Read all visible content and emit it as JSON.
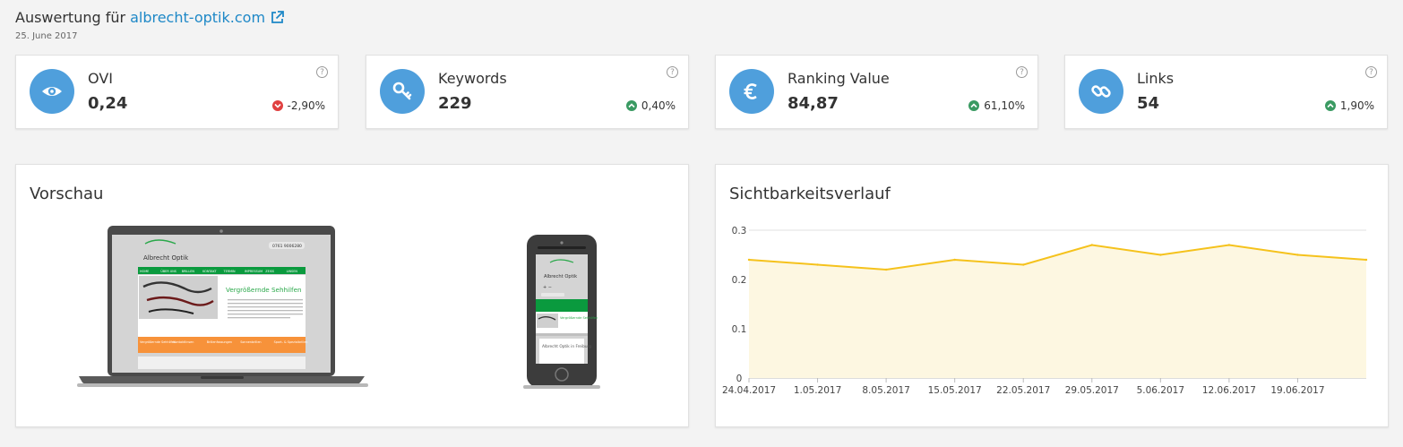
{
  "header": {
    "title_prefix": "Auswertung für",
    "domain": "albrecht-optik.com",
    "date": "25. June 2017"
  },
  "kpis": [
    {
      "label": "OVI",
      "value": "0,24",
      "change": "-2,90%",
      "direction": "down",
      "icon": "eye-icon"
    },
    {
      "label": "Keywords",
      "value": "229",
      "change": "0,40%",
      "direction": "up",
      "icon": "key-icon"
    },
    {
      "label": "Ranking Value",
      "value": "84,87",
      "change": "61,10%",
      "direction": "up",
      "icon": "euro-icon"
    },
    {
      "label": "Links",
      "value": "54",
      "change": "1,90%",
      "direction": "up",
      "icon": "link-icon"
    }
  ],
  "help_symbol": "?",
  "preview": {
    "title": "Vorschau",
    "site": {
      "logo_text": "Albrecht Optik",
      "phone": "0761 9006280",
      "nav_items": [
        "HOME",
        "ÜBER UNS",
        "BRILLEN",
        "KONTAKT",
        "TERMIN",
        "IMPRESSUM",
        "ZEISS",
        "LINSEN"
      ],
      "hero_title": "Vergrößernde Sehhilfen",
      "feature_items": [
        "Vergrößernde Sehhilfen",
        "Kontaktlinsen",
        "Brillenfassungen",
        "Sonnenbrillen",
        "Sport- & Spezialbrillen"
      ],
      "mobile_hero": "Vergrößernde Sehhilfen",
      "mobile_text": "Albrecht Optik in Freiburg"
    }
  },
  "visibility": {
    "title": "Sichtbarkeitsverlauf"
  },
  "colors": {
    "accent": "#4f9fdc",
    "link": "#1e88c7",
    "up": "#3a9a62",
    "down": "#e04040",
    "line": "#f5c21c",
    "area": "#fdf7e1"
  },
  "chart_data": {
    "type": "area",
    "x_ticks": [
      "24.04.2017",
      "1.05.2017",
      "8.05.2017",
      "15.05.2017",
      "22.05.2017",
      "29.05.2017",
      "5.06.2017",
      "12.06.2017",
      "19.06.2017"
    ],
    "x": [
      "24.04.2017",
      "1.05.2017",
      "8.05.2017",
      "15.05.2017",
      "22.05.2017",
      "29.05.2017",
      "5.06.2017",
      "12.06.2017",
      "19.06.2017",
      "26.06.2017"
    ],
    "series": [
      {
        "values": [
          0.24,
          0.23,
          0.22,
          0.24,
          0.23,
          0.27,
          0.25,
          0.27,
          0.25,
          0.24
        ]
      }
    ],
    "y_ticks": [
      "0",
      "0.1",
      "0.2",
      "0.3"
    ],
    "ylim": [
      0,
      0.3
    ],
    "grid": true
  }
}
